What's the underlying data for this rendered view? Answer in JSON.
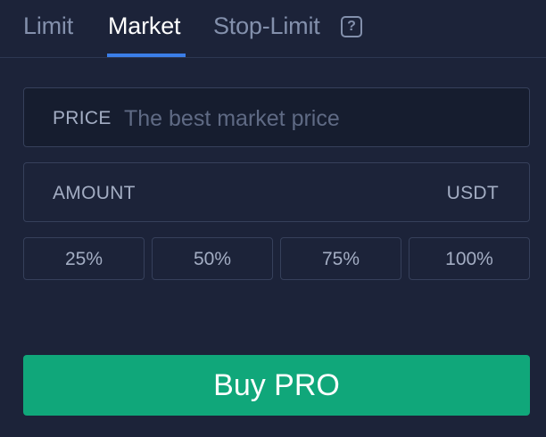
{
  "tabs": [
    {
      "label": "Limit",
      "active": false
    },
    {
      "label": "Market",
      "active": true
    },
    {
      "label": "Stop-Limit",
      "active": false
    }
  ],
  "help_icon": {
    "name": "question-icon",
    "glyph": "?"
  },
  "price": {
    "label": "PRICE",
    "placeholder": "The best market price"
  },
  "amount": {
    "label": "AMOUNT",
    "value": "",
    "unit": "USDT"
  },
  "percent_buttons": [
    "25%",
    "50%",
    "75%",
    "100%"
  ],
  "buy_button": {
    "label": "Buy PRO"
  },
  "colors": {
    "background": "#1c2339",
    "accent_tab": "#3b7ee8",
    "buy": "#10a77a",
    "muted_text": "#8390ac"
  }
}
